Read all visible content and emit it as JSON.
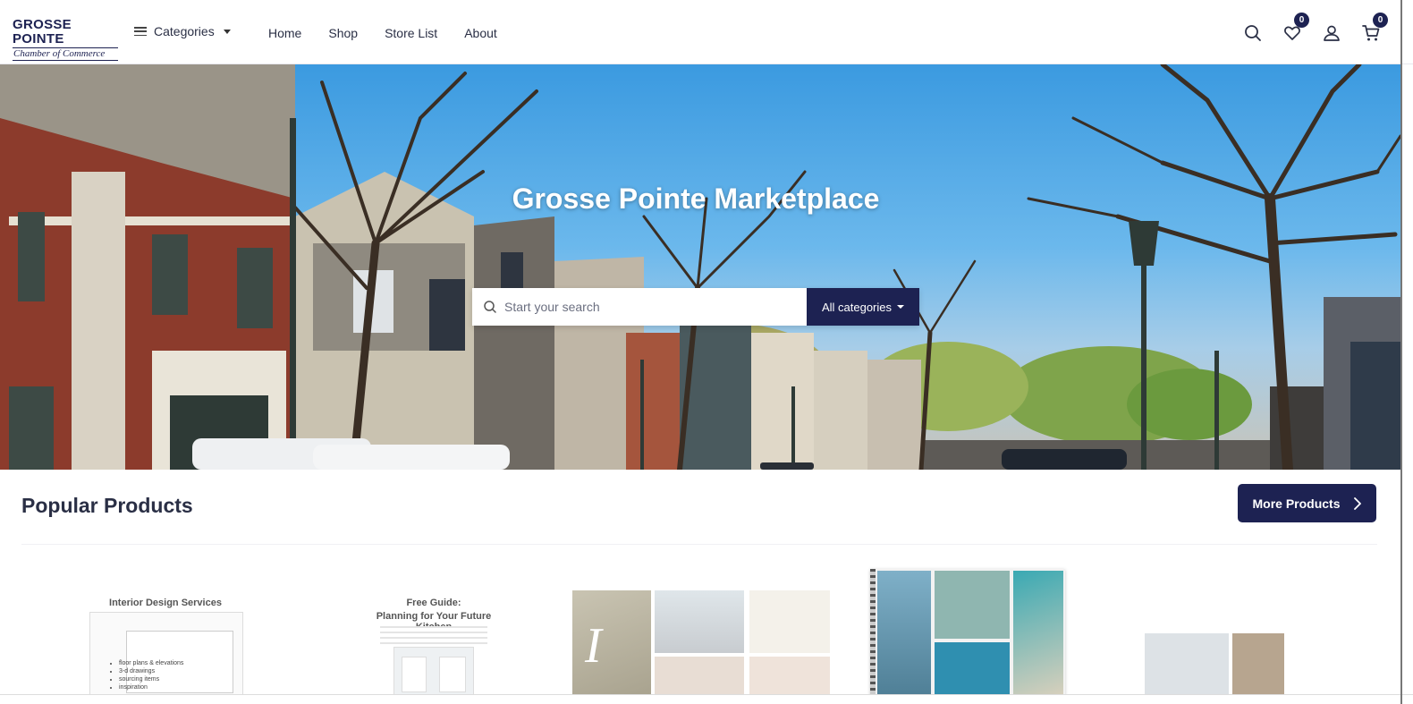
{
  "header": {
    "logo_top": "GROSSE POINTE",
    "logo_bottom": "Chamber of Commerce",
    "categories_label": "Categories",
    "nav": [
      "Home",
      "Shop",
      "Store List",
      "About"
    ],
    "wishlist_count": "0",
    "cart_count": "0"
  },
  "hero": {
    "title": "Grosse Pointe Marketplace",
    "search_placeholder": "Start your search",
    "category_select": "All categories"
  },
  "popular": {
    "title": "Popular Products",
    "more_button": "More Products"
  },
  "products": [
    {
      "title": "Interior Design Services",
      "bullets": [
        "floor plans & elevations",
        "3-d drawings",
        "sourcing items",
        "inspiration"
      ]
    },
    {
      "title_line1": "Free Guide:",
      "title_line2": "Planning for Your Future Kitchen"
    },
    {
      "letter": "I"
    },
    {},
    {}
  ],
  "colors": {
    "brand_navy": "#1d2252",
    "sky": "#3b9ae0"
  }
}
